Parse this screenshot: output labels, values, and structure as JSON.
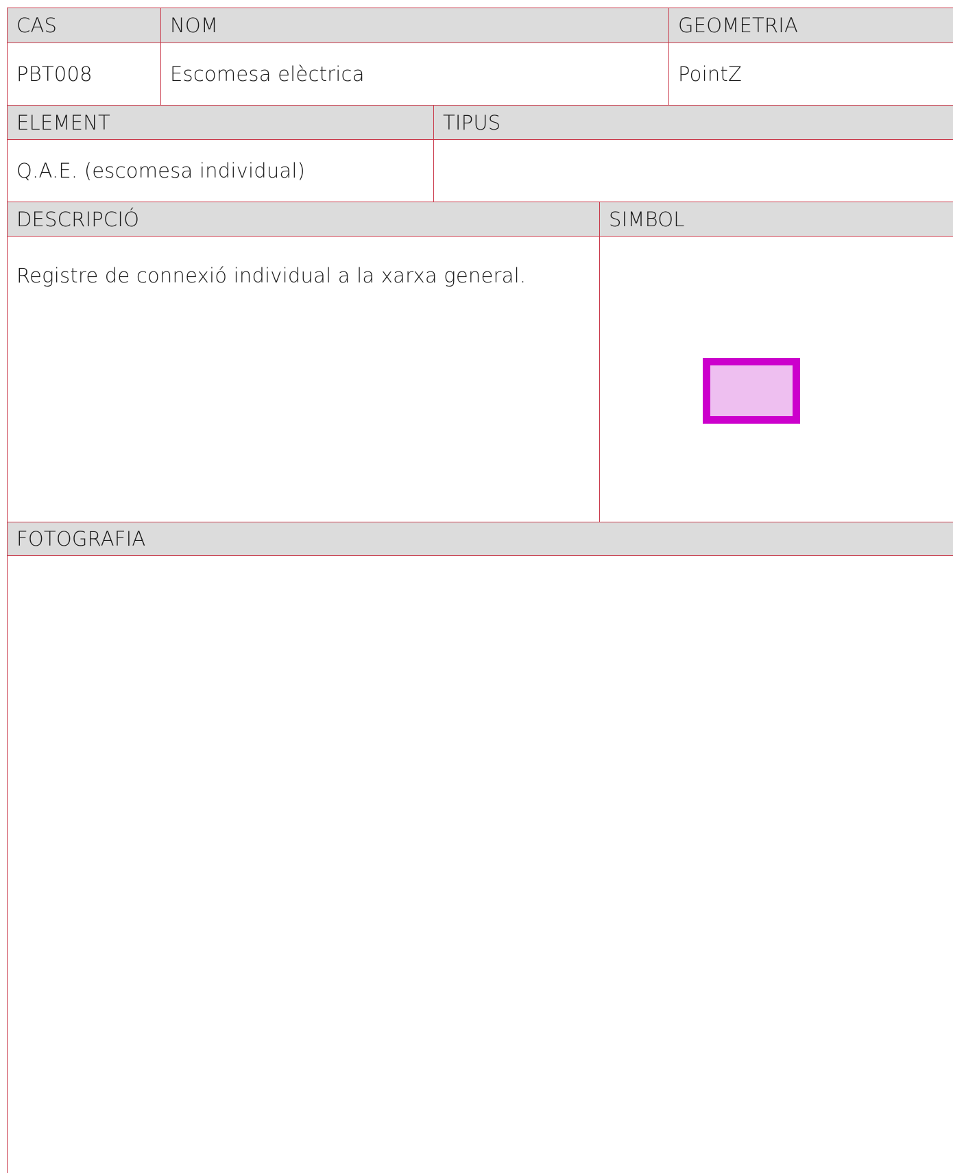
{
  "sheet": {
    "headers": {
      "cas": "CAS",
      "nom": "NOM",
      "geometria": "GEOMETRIA",
      "element": "ELEMENT",
      "tipus": "TIPUS",
      "descripcio": "DESCRIPCIÓ",
      "simbol": "SIMBOL",
      "fotografia": "FOTOGRAFIA"
    },
    "values": {
      "cas": "PBT008",
      "nom": "Escomesa elèctrica",
      "geometria": "PointZ",
      "element": "Q.A.E. (escomesa individual)",
      "tipus": "",
      "descripcio": "Registre de connexió individual a la xarxa general."
    },
    "symbol": {
      "fill_color": "#eebff0",
      "stroke_color": "#cc00cc"
    },
    "colors": {
      "border": "#c9394a",
      "header_background": "#dcdcdc"
    }
  }
}
